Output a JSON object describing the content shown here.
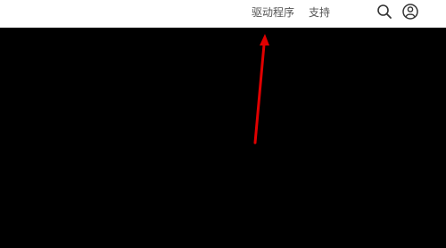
{
  "header": {
    "nav": [
      {
        "label": "驱动程序"
      },
      {
        "label": "支持"
      }
    ],
    "icons": {
      "search": "search-icon",
      "account": "user-account-icon"
    }
  },
  "colors": {
    "header_background": "#ffffff",
    "page_background": "#000000",
    "nav_text": "#555555",
    "icon_stroke": "#333333",
    "annotation_arrow": "#e00000"
  }
}
